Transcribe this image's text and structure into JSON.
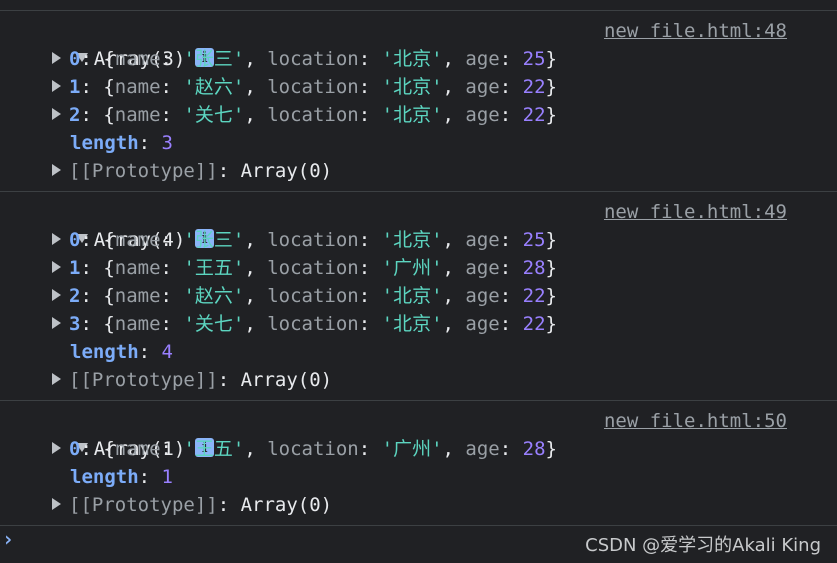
{
  "groups": [
    {
      "header": "Array(3)",
      "source": "new file.html:48",
      "items": [
        {
          "index": "0",
          "name": "'张三'",
          "location": "'北京'",
          "age": "25"
        },
        {
          "index": "1",
          "name": "'赵六'",
          "location": "'北京'",
          "age": "22"
        },
        {
          "index": "2",
          "name": "'关七'",
          "location": "'北京'",
          "age": "22"
        }
      ],
      "length": "3"
    },
    {
      "header": "Array(4)",
      "source": "new file.html:49",
      "items": [
        {
          "index": "0",
          "name": "'张三'",
          "location": "'北京'",
          "age": "25"
        },
        {
          "index": "1",
          "name": "'王五'",
          "location": "'广州'",
          "age": "28"
        },
        {
          "index": "2",
          "name": "'赵六'",
          "location": "'北京'",
          "age": "22"
        },
        {
          "index": "3",
          "name": "'关七'",
          "location": "'北京'",
          "age": "22"
        }
      ],
      "length": "4"
    },
    {
      "header": "Array(1)",
      "source": "new file.html:50",
      "items": [
        {
          "index": "0",
          "name": "'王五'",
          "location": "'广州'",
          "age": "28"
        }
      ],
      "length": "1"
    }
  ],
  "labels": {
    "info_icon": "i",
    "length_key": "length",
    "prototype_key": "[[Prototype]]",
    "prototype_value": "Array(0)",
    "name_key": "name",
    "location_key": "location",
    "age_key": "age"
  },
  "footer": {
    "prompt": "›",
    "watermark": "CSDN @爱学习的Akali King"
  },
  "colors": {
    "background": "#202124",
    "index": "#7cacf8",
    "string": "#5cd5c0",
    "number": "#9980ff",
    "info_icon": "#8ab4f8"
  }
}
